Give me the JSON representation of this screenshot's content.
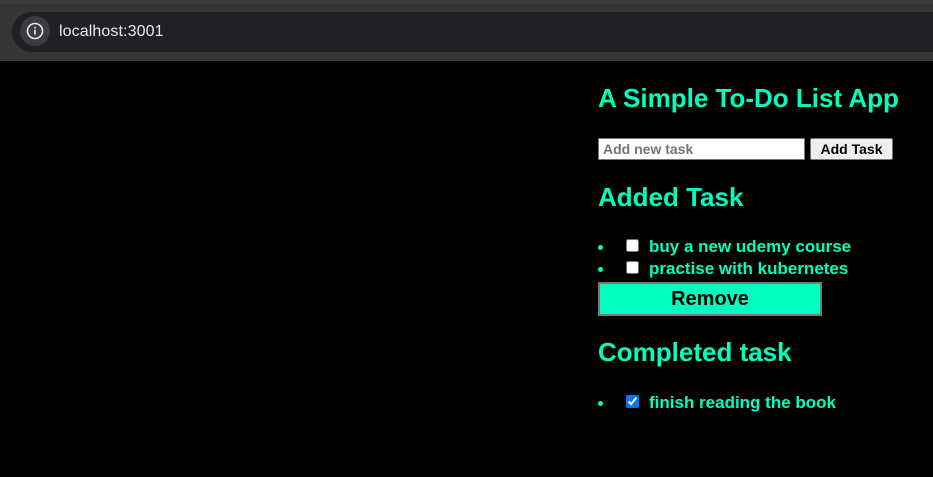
{
  "browser": {
    "url": "localhost:3001"
  },
  "app": {
    "title": "A Simple To-Do List App",
    "input_placeholder": "Add new task",
    "input_value": "",
    "add_button_label": "Add Task",
    "added_section_title": "Added Task",
    "added_tasks": [
      {
        "label": "buy a new udemy course",
        "checked": false
      },
      {
        "label": "practise with kubernetes",
        "checked": false
      }
    ],
    "remove_button_label": "Remove",
    "completed_section_title": "Completed task",
    "completed_tasks": [
      {
        "label": "finish reading the book",
        "checked": true
      }
    ]
  },
  "colors": {
    "accent": "#00ffbf",
    "background": "#000000"
  },
  "icons": {
    "site_info": "info-icon"
  }
}
